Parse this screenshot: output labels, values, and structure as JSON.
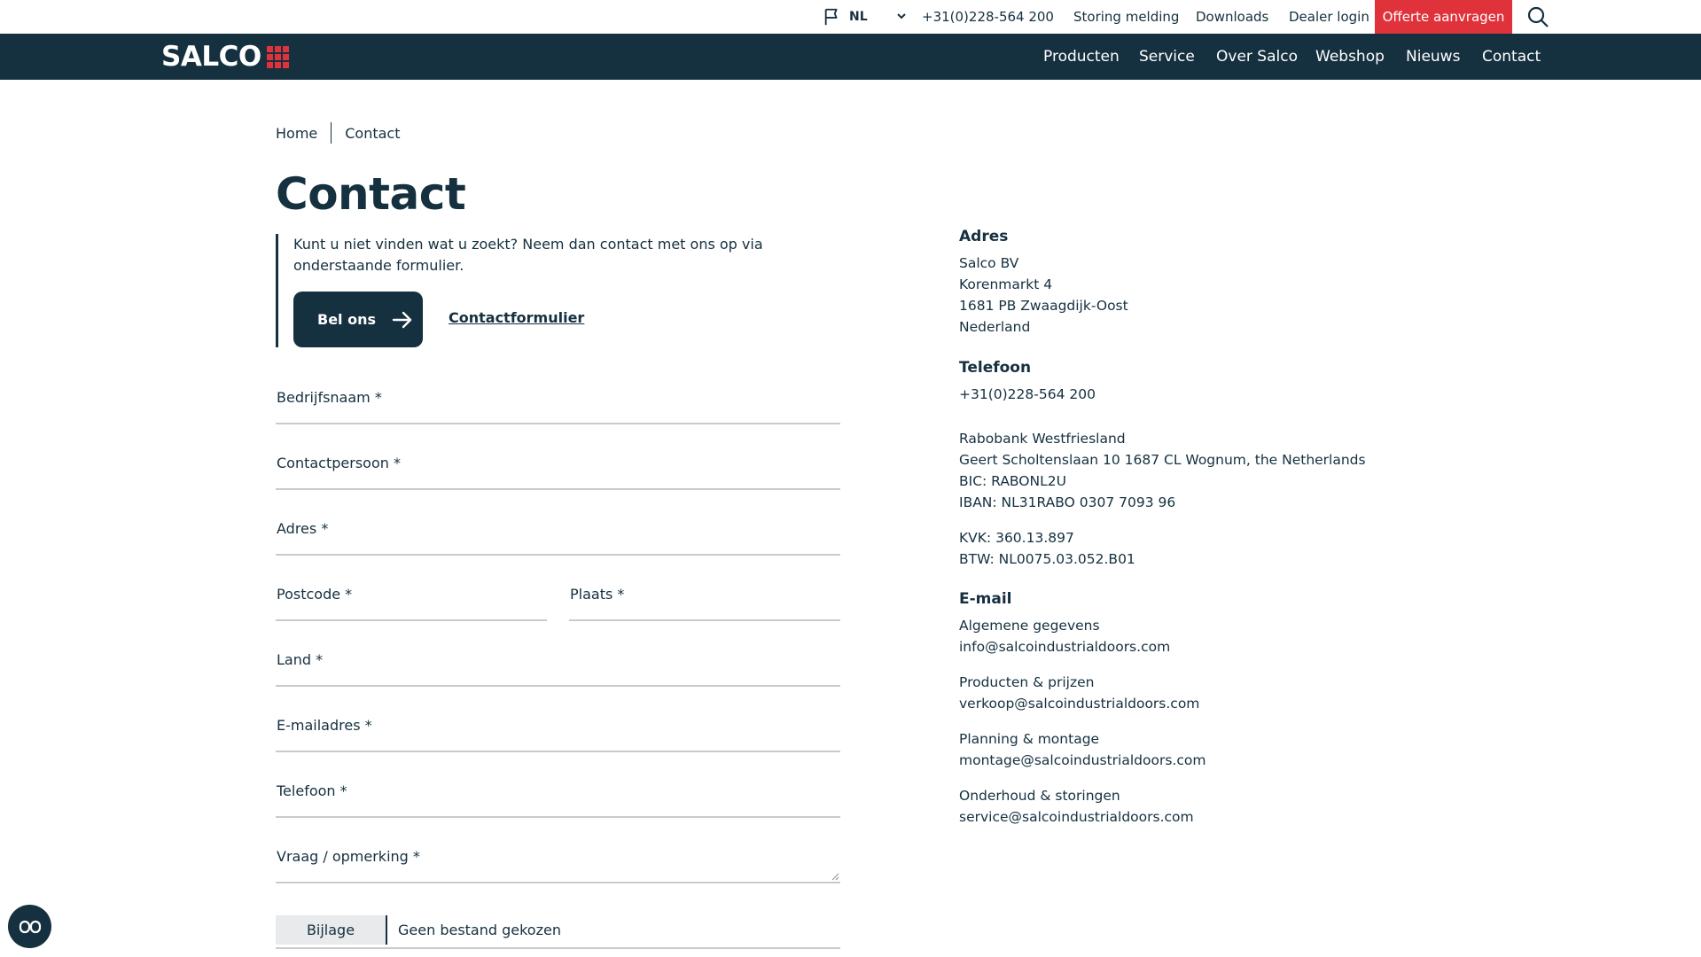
{
  "topbar": {
    "language": "NL",
    "phone": "+31(0)228-564 200",
    "links": [
      "Storing melding",
      "Downloads",
      "Dealer login"
    ],
    "quote_button": "Offerte aanvragen"
  },
  "nav": {
    "logo_text": "SALCO",
    "items": [
      "Producten",
      "Service",
      "Over Salco",
      "Webshop",
      "Nieuws",
      "Contact"
    ]
  },
  "breadcrumb": {
    "home": "Home",
    "current": "Contact"
  },
  "page": {
    "title": "Contact",
    "intro": "Kunt u niet vinden wat u zoekt? Neem dan contact met ons op via onderstaande formulier.",
    "call_button": "Bel ons",
    "form_link": "Contactformulier"
  },
  "form": {
    "company": "Bedrijfsnaam *",
    "contact": "Contactpersoon *",
    "address": "Adres *",
    "postcode": "Postcode *",
    "city": "Plaats *",
    "country": "Land *",
    "email": "E-mailadres *",
    "phone": "Telefoon *",
    "question": "Vraag / opmerking *",
    "attachment_button": "Bijlage",
    "attachment_status": "Geen bestand gekozen"
  },
  "info": {
    "address_heading": "Adres",
    "address_lines": [
      "Salco BV",
      "Korenmarkt 4",
      "1681 PB Zwaagdijk-Oost",
      "Nederland"
    ],
    "phone_heading": "Telefoon",
    "phone": "+31(0)228-564 200",
    "bank_lines": [
      "Rabobank Westfriesland",
      "Geert Scholtenslaan 10  1687 CL Wognum, the Netherlands",
      "BIC: RABONL2U",
      "IBAN: NL31RABO 0307 7093 96"
    ],
    "reg_lines": [
      "KVK: 360.13.897",
      "BTW: NL0075.03.052.B01"
    ],
    "email_heading": "E-mail",
    "emails": [
      {
        "label": "Algemene gegevens",
        "address": "info@salcoindustrialdoors.com"
      },
      {
        "label": "Producten & prijzen",
        "address": "verkoop@salcoindustrialdoors.com"
      },
      {
        "label": "Planning & montage",
        "address": "montage@salcoindustrialdoors.com"
      },
      {
        "label": "Onderhoud & storingen",
        "address": "service@salcoindustrialdoors.com"
      }
    ]
  }
}
